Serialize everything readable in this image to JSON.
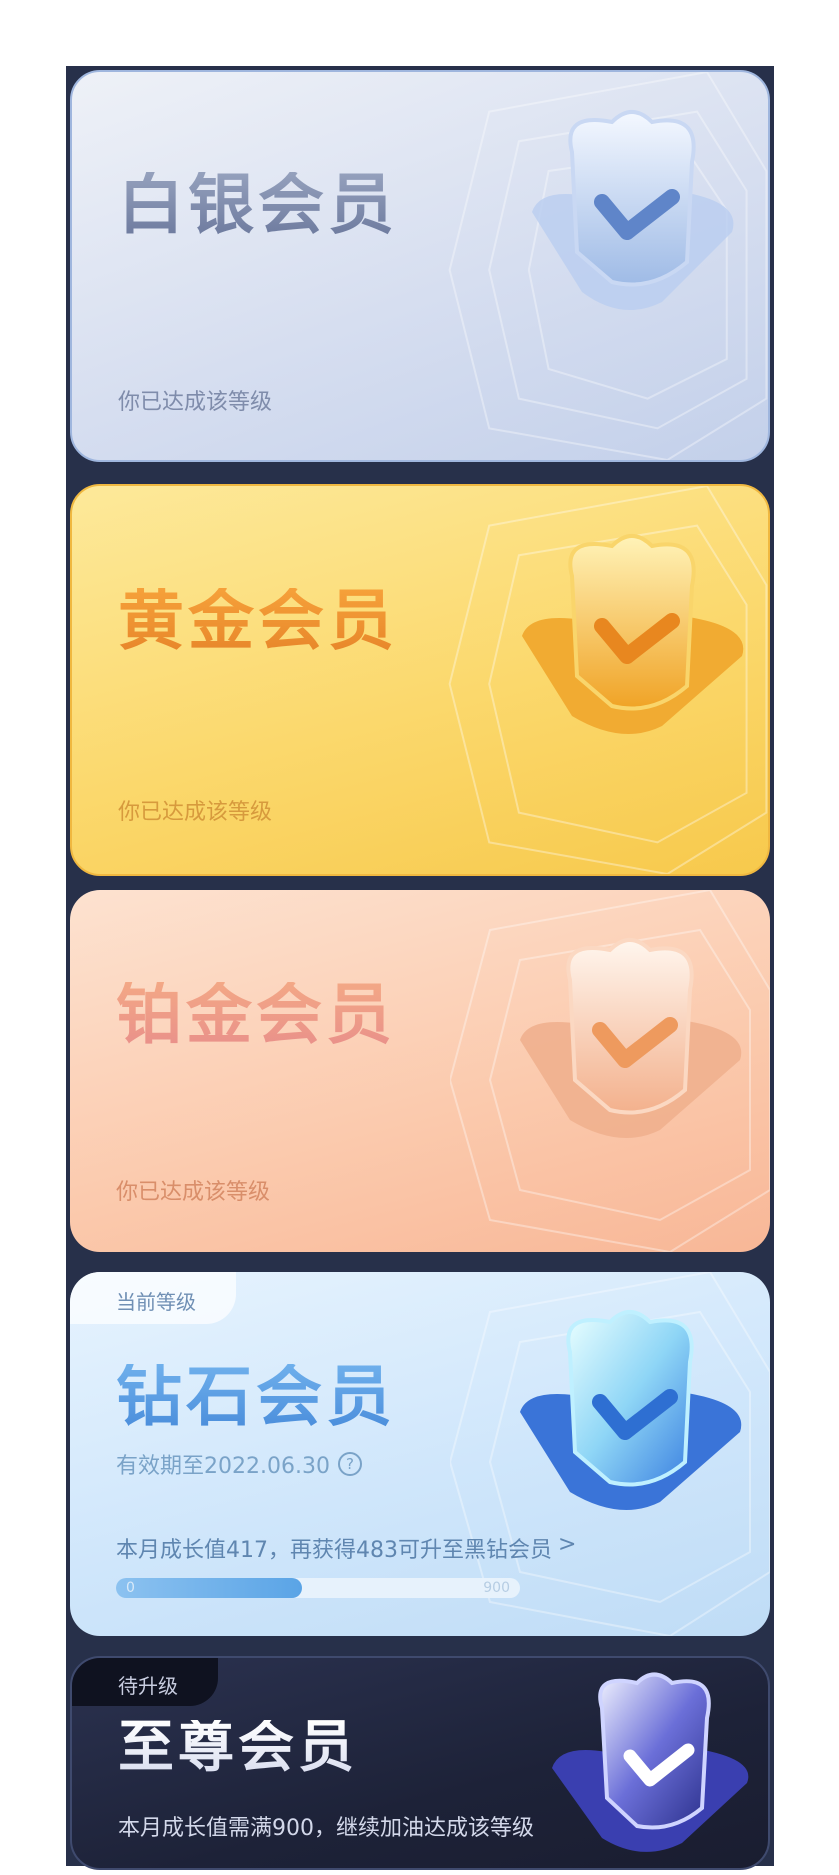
{
  "tiers": {
    "silver": {
      "title": "白银会员",
      "status": "你已达成该等级"
    },
    "gold": {
      "title": "黄金会员",
      "status": "你已达成该等级"
    },
    "platinum": {
      "title": "铂金会员",
      "status": "你已达成该等级"
    },
    "diamond": {
      "tag": "当前等级",
      "title": "钻石会员",
      "validity": "有效期至2022.06.30",
      "growth_text": "本月成长值417，再获得483可升至黑钻会员",
      "growth_arrow": ">",
      "progress": {
        "min": "0",
        "max": "900",
        "fraction": 0.46
      }
    },
    "supreme": {
      "tag": "待升级",
      "title": "至尊会员",
      "status": "本月成长值需满900，继续加油达成该等级"
    }
  },
  "colors": {
    "background_strip": "#27304a",
    "silver_accent": "#7a88ab",
    "gold_accent": "#e7862a",
    "platinum_accent": "#e9908a",
    "diamond_accent": "#4a8ddb"
  },
  "icons": [
    "badge-check-icon",
    "help-circle-icon"
  ]
}
